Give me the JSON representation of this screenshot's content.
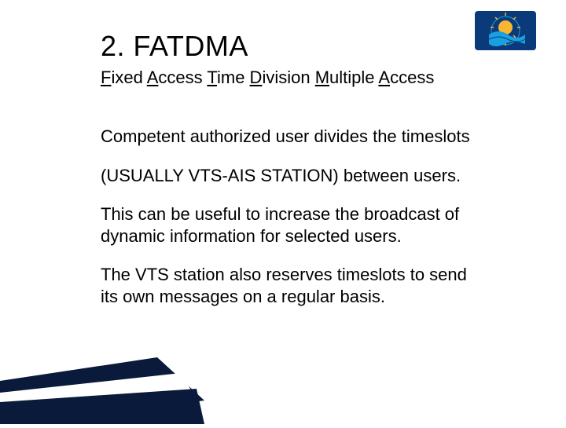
{
  "logo": {
    "bg": "#0a3a7a",
    "sun": "#f7b733",
    "wave": "#1aa0e0"
  },
  "title": "2. FATDMA",
  "subtitle_parts": {
    "f": "F",
    "ixed": "ixed ",
    "a1": "A",
    "ccess1": "ccess  ",
    "t": "T",
    "ime": "ime ",
    "d": "D",
    "ivision": "ivision ",
    "m": "M",
    "ultiple": "ultiple ",
    "a2": "A",
    "ccess2": "ccess"
  },
  "paragraphs": {
    "p1": "Competent authorized user divides the timeslots",
    "p2": "(USUALLY VTS-AIS STATION) between users.",
    "p3": "This can be useful to increase the broadcast of dynamic information for selected users.",
    "p4": "The VTS station also reserves timeslots to send its own messages on a regular basis."
  },
  "decor_colors": {
    "dark": "#0a1a3a",
    "white": "#ffffff"
  }
}
